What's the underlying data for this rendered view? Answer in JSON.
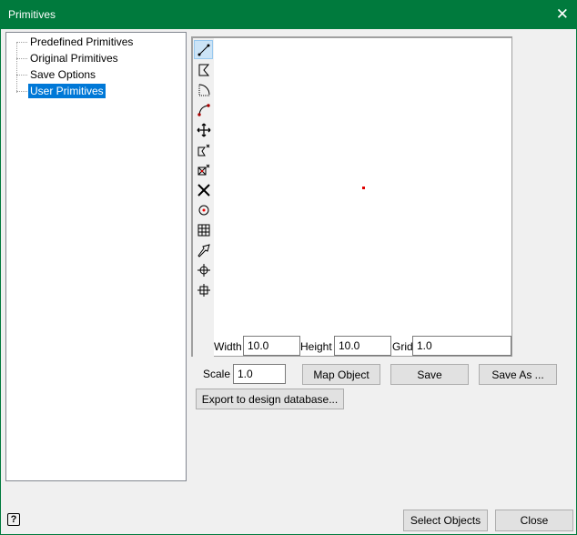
{
  "window": {
    "title": "Primitives",
    "close_icon": "close-icon"
  },
  "tree": {
    "items": [
      {
        "label": "Predefined Primitives",
        "selected": false
      },
      {
        "label": "Original Primitives",
        "selected": false
      },
      {
        "label": "Save Options",
        "selected": false
      },
      {
        "label": "User Primitives",
        "selected": true
      }
    ]
  },
  "toolbar": {
    "tools": [
      "line",
      "polygon",
      "arc-dotted",
      "curve",
      "move",
      "delete-polygon",
      "delete-point",
      "delete-cross",
      "circle-point",
      "grid",
      "arrow",
      "crosshair",
      "crosshair-grid"
    ]
  },
  "canvas": {
    "width_label": "Width",
    "width_value": "10.0",
    "height_label": "Height",
    "height_value": "10.0",
    "grid_label": "Grid",
    "grid_value": "1.0",
    "point_color": "#e00000"
  },
  "controls": {
    "scale_label": "Scale",
    "scale_value": "1.0",
    "map_object": "Map Object",
    "save": "Save",
    "save_as": "Save As ...",
    "export": "Export to design database..."
  },
  "footer": {
    "help_icon": "help-icon",
    "select_objects": "Select Objects",
    "close": "Close"
  },
  "colors": {
    "titlebar": "#007a3d",
    "selection": "#0078d7"
  }
}
